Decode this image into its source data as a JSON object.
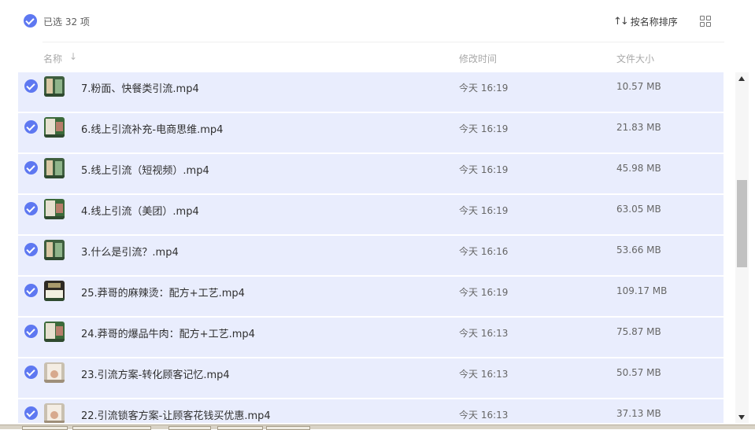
{
  "toolbar": {
    "selection_text": "已选 32 项",
    "sort_label": "按名称排序",
    "sort_icon": "sort-arrows-icon",
    "view_icon": "grid-view-icon"
  },
  "header": {
    "name": "名称",
    "name_sort_arrow": "↓",
    "modified": "修改时间",
    "size": "文件大小"
  },
  "files": [
    {
      "name": "7.粉面、快餐类引流.mp4",
      "modified": "今天 16:19",
      "size": "10.57 MB",
      "selected": true
    },
    {
      "name": "6.线上引流补充-电商思维.mp4",
      "modified": "今天 16:19",
      "size": "21.83 MB",
      "selected": true
    },
    {
      "name": "5.线上引流（短视频）.mp4",
      "modified": "今天 16:19",
      "size": "45.98 MB",
      "selected": true
    },
    {
      "name": "4.线上引流（美团）.mp4",
      "modified": "今天 16:19",
      "size": "63.05 MB",
      "selected": true
    },
    {
      "name": "3.什么是引流？.mp4",
      "modified": "今天 16:16",
      "size": "53.66 MB",
      "selected": true
    },
    {
      "name": "25.莽哥的麻辣烫：配方+工艺.mp4",
      "modified": "今天 16:19",
      "size": "109.17 MB",
      "selected": true
    },
    {
      "name": "24.莽哥的爆品牛肉：配方+工艺.mp4",
      "modified": "今天 16:13",
      "size": "75.87 MB",
      "selected": true
    },
    {
      "name": "23.引流方案-转化顾客记忆.mp4",
      "modified": "今天 16:13",
      "size": "50.57 MB",
      "selected": true
    },
    {
      "name": "22.引流锁客方案-让顾客花钱买优惠.mp4",
      "modified": "今天 16:13",
      "size": "37.13 MB",
      "selected": true
    }
  ],
  "colors": {
    "accent": "#5e78f1",
    "row_selected_bg": "#e9edfd"
  }
}
